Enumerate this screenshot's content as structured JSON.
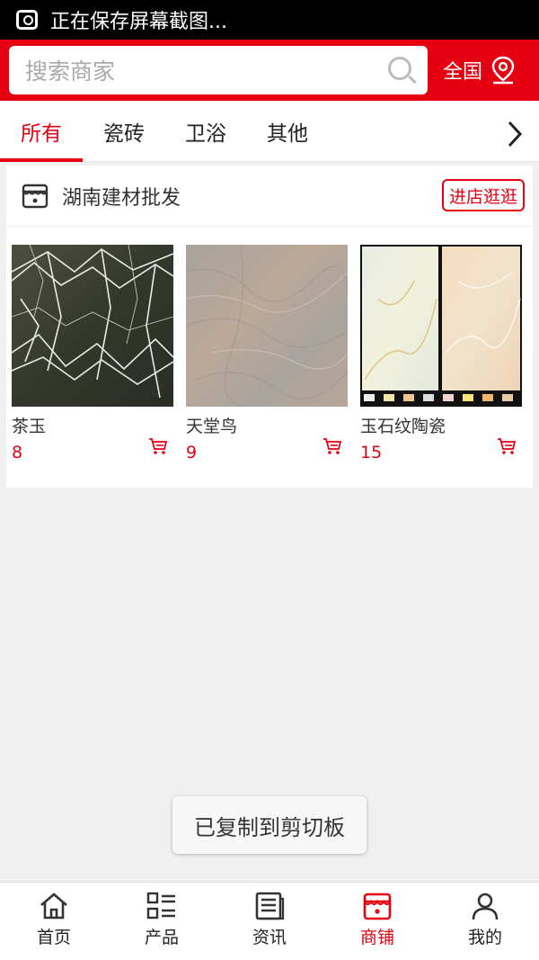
{
  "statusbar": {
    "text": "正在保存屏幕截图..."
  },
  "header": {
    "search_placeholder": "搜索商家",
    "region_label": "全国"
  },
  "tabs": [
    {
      "label": "所有",
      "active": true
    },
    {
      "label": "瓷砖",
      "active": false
    },
    {
      "label": "卫浴",
      "active": false
    },
    {
      "label": "其他",
      "active": false
    }
  ],
  "store": {
    "name": "湖南建材批发",
    "visit_label": "进店逛逛",
    "products": [
      {
        "name": "茶玉",
        "price": "8"
      },
      {
        "name": "天堂鸟",
        "price": "9"
      },
      {
        "name": "玉石纹陶瓷",
        "price": "15"
      }
    ]
  },
  "toast": {
    "text": "已复制到剪切板"
  },
  "bottom_nav": [
    {
      "label": "首页",
      "icon": "home-icon"
    },
    {
      "label": "产品",
      "icon": "list-icon"
    },
    {
      "label": "资讯",
      "icon": "news-icon"
    },
    {
      "label": "商铺",
      "icon": "store-icon",
      "active": true
    },
    {
      "label": "我的",
      "icon": "user-icon"
    }
  ],
  "colors": {
    "accent": "#e50012",
    "background": "#f0f0f0"
  }
}
